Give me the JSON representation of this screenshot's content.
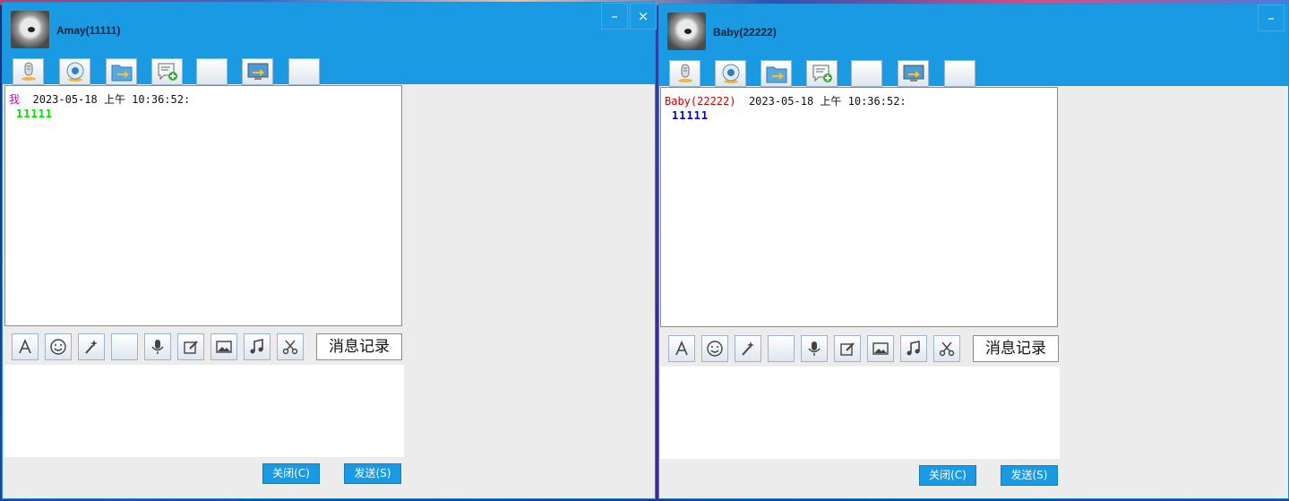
{
  "windows": [
    {
      "contact": "Amay(11111)",
      "controls": {
        "minimize": "–",
        "close": "×"
      },
      "message": {
        "sender": "我",
        "sender_color": "#cc00cc",
        "timestamp": "2023-05-18 上午 10:36:52:",
        "text": "11111",
        "text_color": "#00dd00"
      },
      "history_label": "消息记录",
      "buttons": {
        "close": "关闭(C)",
        "send": "发送(S)"
      }
    },
    {
      "contact": "Baby(22222)",
      "controls": {
        "minimize": "–"
      },
      "message": {
        "sender": "Baby(22222)",
        "sender_color": "#cc0000",
        "timestamp": "2023-05-18 上午 10:36:52:",
        "text": "11111",
        "text_color": "#0000cc"
      },
      "history_label": "消息记录",
      "buttons": {
        "close": "关闭(C)",
        "send": "发送(S)"
      }
    }
  ],
  "toolbar_icons": [
    "microphone-icon",
    "webcam-icon",
    "file-transfer-icon",
    "add-message-icon",
    "blank-icon",
    "screen-share-icon",
    "blank-icon"
  ],
  "format_icons": [
    "font-icon",
    "emoji-icon",
    "magic-wand-icon",
    "blank-icon",
    "voice-icon",
    "edit-icon",
    "image-icon",
    "music-icon",
    "scissors-icon"
  ],
  "colors": {
    "titlebar": "#1a9ae2",
    "button": "#1a9ae2"
  }
}
